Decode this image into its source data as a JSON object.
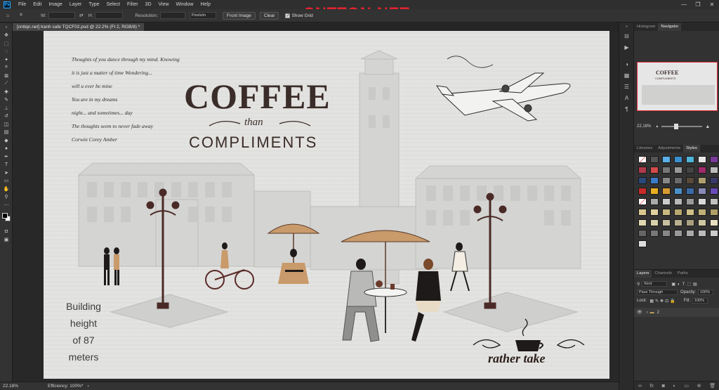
{
  "menubar": {
    "logo": "Ps",
    "items": [
      "File",
      "Edit",
      "Image",
      "Layer",
      "Type",
      "Select",
      "Filter",
      "3D",
      "View",
      "Window",
      "Help"
    ],
    "watermark": "CNTTQN.NET",
    "window_controls": [
      "—",
      "❐",
      "✕"
    ]
  },
  "options": {
    "w_label": "W:",
    "h_label": "H:",
    "resolution_label": "Resolution:",
    "units_value": "Pixels/in",
    "front_image_label": "Front Image",
    "clear_label": "Clear",
    "show_grid_label": "Show Grid"
  },
  "document": {
    "tab_title": "[cnttqn.net] tranh cafe TQCF02.psd @ 22.2% (Ft 2, RGB/8) *"
  },
  "artwork": {
    "poem": [
      "Thoughts of you dance through my mind. Knowing",
      "it is just a matter of time Wondering...",
      "will u ever be mine",
      "You are in my dreams",
      "night... and sometimes... day",
      "The thoughts seem to never fade away",
      "Corwin Corey Amber"
    ],
    "title": "COFFEE",
    "than": "than",
    "subtitle": "COMPLIMENTS",
    "building_note": [
      "Building",
      "height",
      "of 87",
      "meters"
    ],
    "rather_take": "rather take"
  },
  "status": {
    "zoom": "22.18%",
    "efficiency": "Efficiency: 100%*"
  },
  "panels": {
    "nav_tabs": [
      "Histogram",
      "Navigator"
    ],
    "nav_zoom": "22.18%",
    "nav_thumb_title": "COFFEE",
    "nav_thumb_sub": "COMPLIMENTS",
    "style_tabs": [
      "Libraries",
      "Adjustments",
      "Styles"
    ],
    "layers_tabs": [
      "Layers",
      "Channels",
      "Paths"
    ],
    "kind_label": "Kind",
    "blend_mode": "Pass Through",
    "opacity_label": "Opacity:",
    "opacity_value": "100%",
    "lock_label": "Lock:",
    "fill_label": "Fill:",
    "fill_value": "100%",
    "layer_name": "2"
  },
  "colors": {
    "accent_red": "#e12e38",
    "coffee_brown": "#3a2c28",
    "umbrella": "#c99a6a"
  }
}
